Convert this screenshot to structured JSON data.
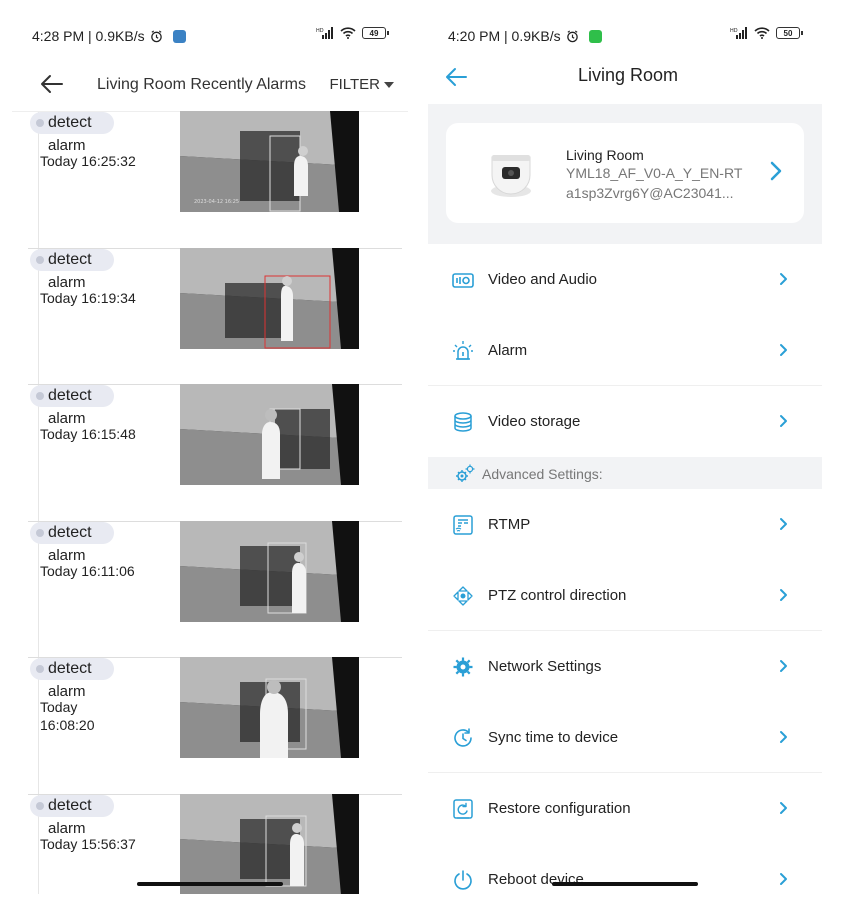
{
  "left_screen": {
    "status": {
      "time": "4:28 PM | 0.9KB/s",
      "battery": "49"
    },
    "header": {
      "title": "Living Room Recently Alarms",
      "filter_label": "FILTER"
    },
    "alarms": [
      {
        "type": "detect",
        "label": "alarm",
        "time": "Today 16:25:32"
      },
      {
        "type": "detect",
        "label": "alarm",
        "time": "Today 16:19:34"
      },
      {
        "type": "detect",
        "label": "alarm",
        "time": "Today 16:15:48"
      },
      {
        "type": "detect",
        "label": "alarm",
        "time": "Today 16:11:06"
      },
      {
        "type": "detect",
        "label": "alarm",
        "time": "Today 16:08:20"
      },
      {
        "type": "detect",
        "label": "alarm",
        "time": "Today 15:56:37"
      }
    ]
  },
  "right_screen": {
    "status": {
      "time": "4:20 PM | 0.9KB/s",
      "battery": "50"
    },
    "header": {
      "title": "Living Room"
    },
    "device": {
      "name": "Living Room",
      "model": "YML18_AF_V0-A_Y_EN-RT",
      "uid": "a1sp3Zvrg6Y@AC23041..."
    },
    "menu": [
      {
        "label": "Video and Audio",
        "icon": "video-audio-icon"
      },
      {
        "label": "Alarm",
        "icon": "alarm-siren-icon"
      },
      {
        "label": "Video storage",
        "icon": "database-icon"
      },
      {
        "label": "RTMP",
        "icon": "rtmp-stream-icon"
      },
      {
        "label": "PTZ control direction",
        "icon": "ptz-direction-icon"
      },
      {
        "label": "Network Settings",
        "icon": "network-gear-icon"
      },
      {
        "label": "Sync time to device",
        "icon": "sync-clock-icon"
      },
      {
        "label": "Restore configuration",
        "icon": "restore-icon"
      },
      {
        "label": "Reboot device",
        "icon": "power-icon"
      }
    ],
    "advanced_label": "Advanced Settings:"
  },
  "colors": {
    "accent": "#2a9fd6",
    "pill_bg": "#e8eaf2",
    "section_bg": "#f2f3f5"
  }
}
